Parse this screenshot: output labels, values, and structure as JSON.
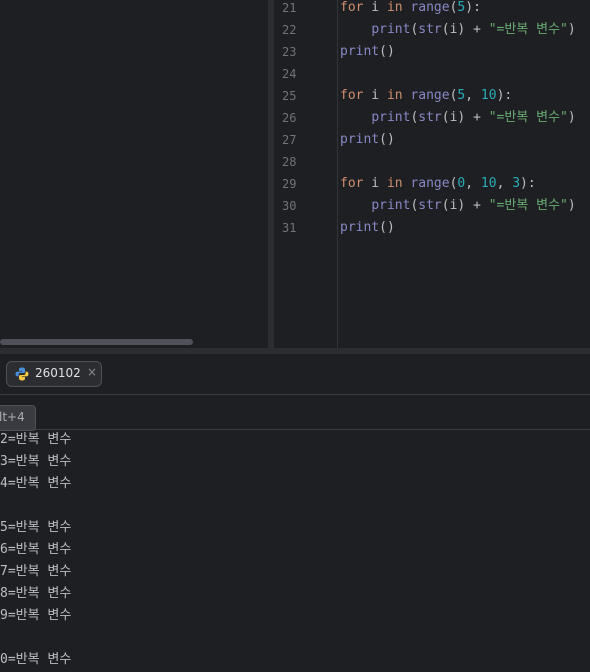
{
  "editor": {
    "lines": [
      {
        "num": "21",
        "code": [
          {
            "t": "for",
            "c": "kw"
          },
          {
            "t": " i "
          },
          {
            "t": "in",
            "c": "kw"
          },
          {
            "t": " "
          },
          {
            "t": "range",
            "c": "bi"
          },
          {
            "t": "("
          },
          {
            "t": "5",
            "c": "num"
          },
          {
            "t": "):"
          }
        ]
      },
      {
        "num": "22",
        "code": [
          {
            "t": "    "
          },
          {
            "t": "print",
            "c": "bi"
          },
          {
            "t": "("
          },
          {
            "t": "str",
            "c": "bi"
          },
          {
            "t": "(i) + "
          },
          {
            "t": "\"=반복 변수\"",
            "c": "str"
          },
          {
            "t": ")"
          }
        ]
      },
      {
        "num": "23",
        "code": [
          {
            "t": "print",
            "c": "bi"
          },
          {
            "t": "()"
          }
        ]
      },
      {
        "num": "24",
        "code": []
      },
      {
        "num": "25",
        "code": [
          {
            "t": "for",
            "c": "kw"
          },
          {
            "t": " i "
          },
          {
            "t": "in",
            "c": "kw"
          },
          {
            "t": " "
          },
          {
            "t": "range",
            "c": "bi"
          },
          {
            "t": "("
          },
          {
            "t": "5",
            "c": "num"
          },
          {
            "t": ", "
          },
          {
            "t": "10",
            "c": "num"
          },
          {
            "t": "):"
          }
        ]
      },
      {
        "num": "26",
        "code": [
          {
            "t": "    "
          },
          {
            "t": "print",
            "c": "bi"
          },
          {
            "t": "("
          },
          {
            "t": "str",
            "c": "bi"
          },
          {
            "t": "(i) + "
          },
          {
            "t": "\"=반복 변수\"",
            "c": "str"
          },
          {
            "t": ")"
          }
        ]
      },
      {
        "num": "27",
        "code": [
          {
            "t": "print",
            "c": "bi"
          },
          {
            "t": "()"
          }
        ]
      },
      {
        "num": "28",
        "code": []
      },
      {
        "num": "29",
        "code": [
          {
            "t": "for",
            "c": "kw"
          },
          {
            "t": " i "
          },
          {
            "t": "in",
            "c": "kw"
          },
          {
            "t": " "
          },
          {
            "t": "range",
            "c": "bi"
          },
          {
            "t": "("
          },
          {
            "t": "0",
            "c": "num"
          },
          {
            "t": ", "
          },
          {
            "t": "10",
            "c": "num"
          },
          {
            "t": ", "
          },
          {
            "t": "3",
            "c": "num"
          },
          {
            "t": "):"
          }
        ]
      },
      {
        "num": "30",
        "code": [
          {
            "t": "    "
          },
          {
            "t": "print",
            "c": "bi"
          },
          {
            "t": "("
          },
          {
            "t": "str",
            "c": "bi"
          },
          {
            "t": "(i) + "
          },
          {
            "t": "\"=반복 변수\"",
            "c": "str"
          },
          {
            "t": ")"
          }
        ]
      },
      {
        "num": "31",
        "code": [
          {
            "t": "print",
            "c": "bi"
          },
          {
            "t": "()"
          }
        ]
      }
    ]
  },
  "run_panel": {
    "tab_label": "260102",
    "tab_icon": "python-icon",
    "close_glyph": "×",
    "tooltip": "lt+4",
    "output": [
      "2=반복 변수",
      "3=반복 변수",
      "4=반복 변수",
      "",
      "5=반복 변수",
      "6=반복 변수",
      "7=반복 변수",
      "8=반복 변수",
      "9=반복 변수",
      "",
      "0=반복 변수"
    ]
  },
  "colors": {
    "background": "#1e1f22",
    "keyword": "#cf8e6d",
    "builtin": "#8888c6",
    "number": "#2aacb8",
    "string": "#6aab73"
  }
}
